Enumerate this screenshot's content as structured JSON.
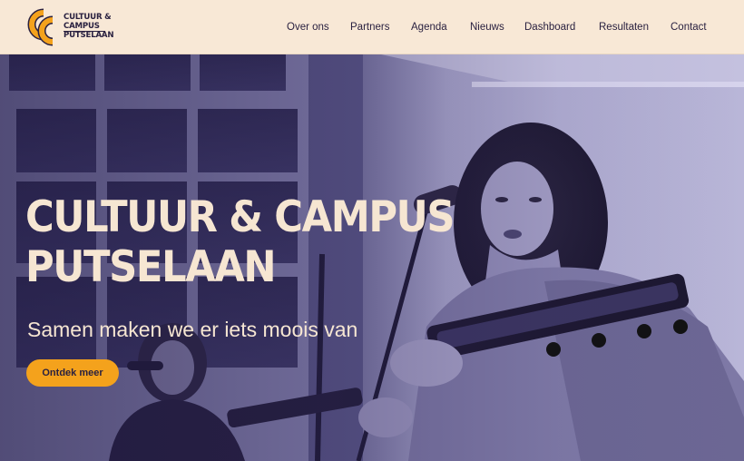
{
  "brand": {
    "logo_line1": "CULTUUR &",
    "logo_line2": "CAMPUS",
    "logo_line3": "PUTSELAAN",
    "logo_mark": "CC",
    "accent_color": "#f4a21c",
    "ink_color": "#2a2140",
    "cream_color": "#f6e6d2"
  },
  "nav": {
    "items": [
      {
        "label": "Over ons"
      },
      {
        "label": "Partners"
      },
      {
        "label": "Agenda"
      },
      {
        "label": "Nieuws"
      },
      {
        "label": "Dashboard"
      },
      {
        "label": "Resultaten"
      },
      {
        "label": "Contact"
      }
    ]
  },
  "hero": {
    "title": "CULTUUR & CAMPUS PUTSELAAN",
    "subtitle": "Samen maken we er iets moois van",
    "cta_label": "Ontdek meer",
    "photo_icon": "musicians-performing-photo"
  }
}
